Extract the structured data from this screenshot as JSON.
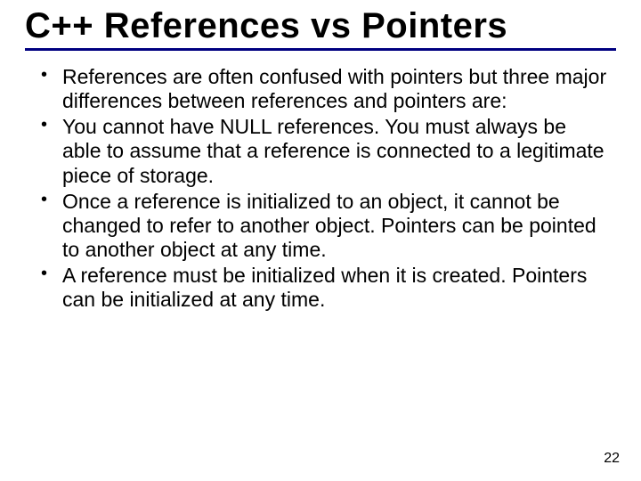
{
  "slide": {
    "title": "C++ References vs Pointers",
    "bullets": [
      "References are often confused with pointers but three major differences between references and pointers are:",
      "You cannot have NULL references. You must always be able to assume that a reference is connected to a legitimate piece of storage.",
      "Once a reference is initialized to an object, it cannot be changed to refer to another object. Pointers can be pointed to another object at any time.",
      "A reference must be initialized when it is created. Pointers can be initialized at any time."
    ],
    "page_number": "22"
  }
}
